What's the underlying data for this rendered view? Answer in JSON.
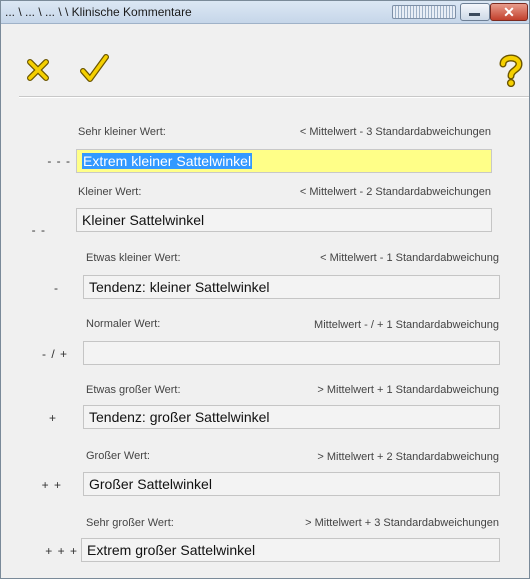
{
  "window": {
    "title": "... \\ ... \\ ... \\ \\ Klinische Kommentare",
    "close_label": "✕"
  },
  "toolbar": {
    "cancel_icon": "x-icon",
    "ok_icon": "checkmark-icon",
    "help_icon": "question-icon"
  },
  "colors": {
    "active_field_bg": "#ffff88",
    "selection_bg": "#3399ff",
    "icon_yellow": "#f5d000"
  },
  "rows": [
    {
      "label": "Sehr kleiner Wert:",
      "range": "< Mittelwert - 3 Standardabweichungen",
      "symbol": "- - -",
      "value": "Extrem kleiner Sattelwinkel"
    },
    {
      "label": "Kleiner Wert:",
      "range": "< Mittelwert - 2 Standardabweichungen",
      "symbol": "- -",
      "value": "Kleiner Sattelwinkel"
    },
    {
      "label": "Etwas kleiner Wert:",
      "range": "< Mittelwert - 1 Standardabweichung",
      "symbol": "-",
      "value": "Tendenz: kleiner Sattelwinkel"
    },
    {
      "label": "Normaler Wert:",
      "range": "Mittelwert - / + 1 Standardabweichung",
      "symbol": "- / +",
      "value": ""
    },
    {
      "label": "Etwas großer Wert:",
      "range": "> Mittelwert + 1 Standardabweichung",
      "symbol": "+",
      "value": "Tendenz: großer Sattelwinkel"
    },
    {
      "label": "Großer Wert:",
      "range": "> Mittelwert + 2 Standardabweichung",
      "symbol": "+ +",
      "value": "Großer Sattelwinkel"
    },
    {
      "label": "Sehr großer Wert:",
      "range": "> Mittelwert + 3 Standardabweichungen",
      "symbol": "+ + +",
      "value": "Extrem großer Sattelwinkel"
    }
  ]
}
